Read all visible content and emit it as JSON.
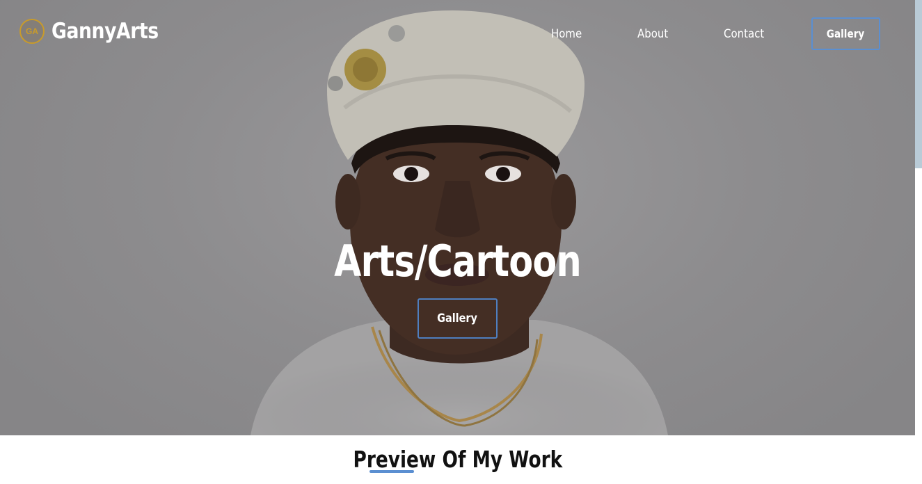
{
  "brand": {
    "logo_text": "GA",
    "name": "GannyArts"
  },
  "nav": {
    "links": [
      "Home",
      "About",
      "Contact"
    ],
    "gallery_button": "Gallery"
  },
  "hero": {
    "title": "Arts/Cartoon",
    "button": "Gallery"
  },
  "section": {
    "title": "Preview Of My Work"
  },
  "colors": {
    "accent": "#5b8fd1",
    "overlay": "#8a898b",
    "logo_gold": "#c99b2a"
  }
}
